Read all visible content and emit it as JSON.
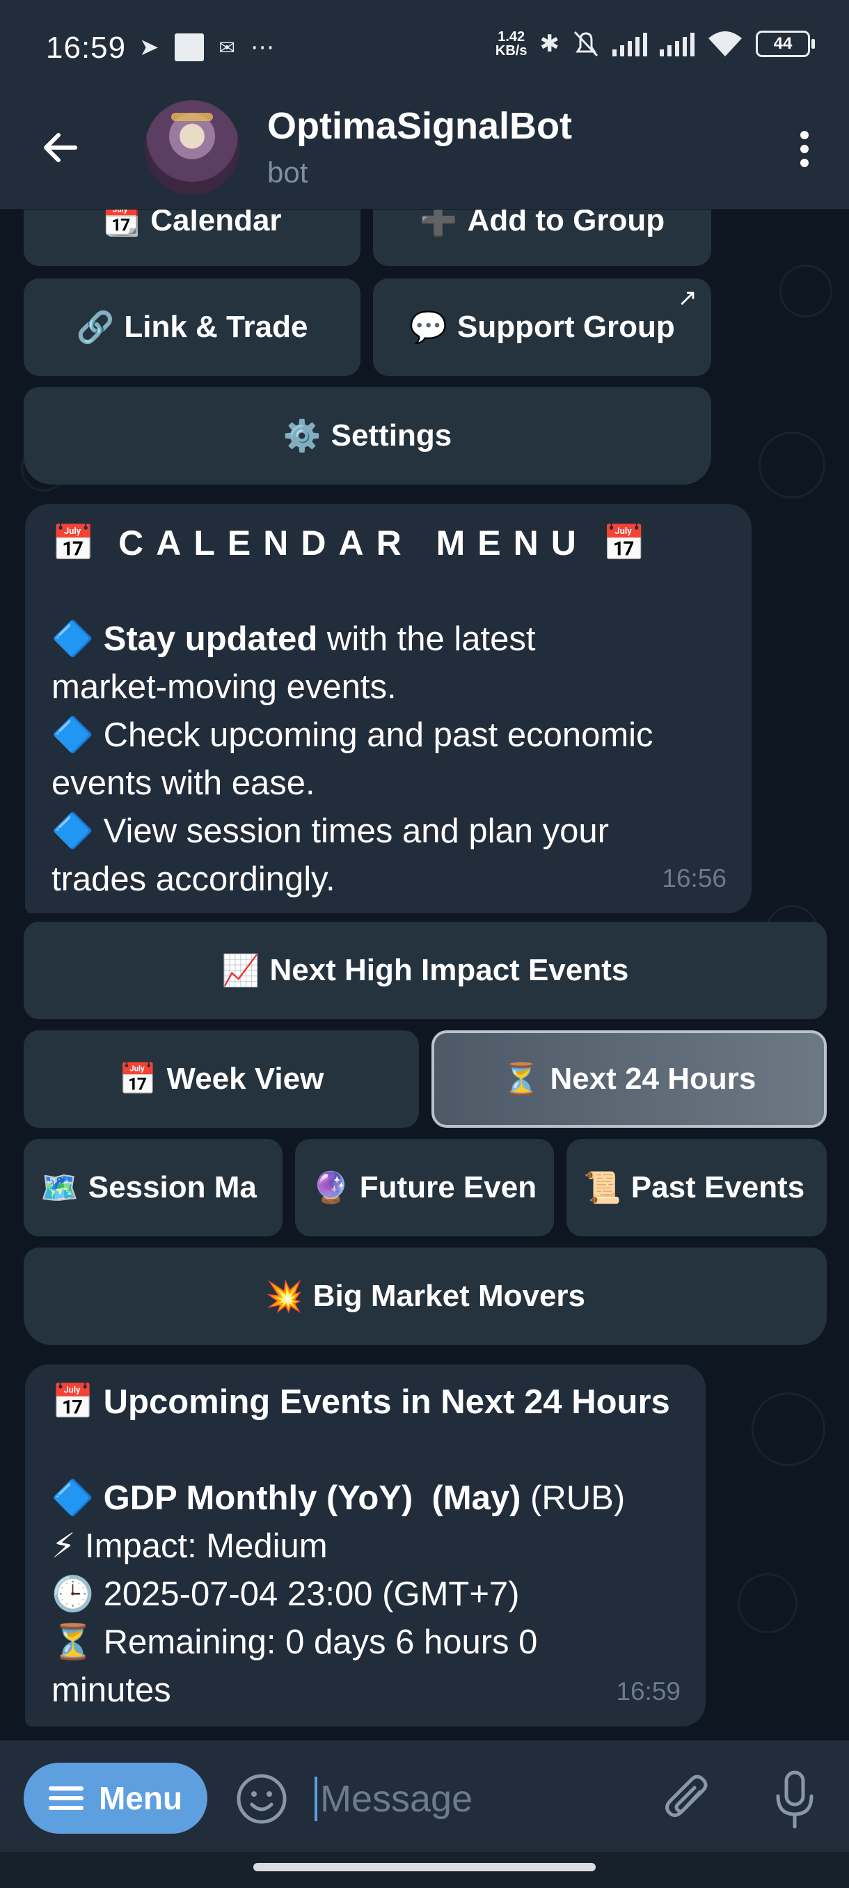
{
  "status_bar": {
    "time": "16:59",
    "net_speed_value": "1.42",
    "net_speed_unit": "KB/s",
    "battery": "44",
    "icons": [
      "telegram-icon",
      "square-notification-icon",
      "mail-icon",
      "more-dots-icon",
      "bluetooth-icon",
      "bell-off-icon",
      "signal-icon",
      "signal-icon",
      "wifi-icon",
      "battery-icon"
    ]
  },
  "header": {
    "title": "OptimaSignalBot",
    "subtitle": "bot"
  },
  "top_keyboard": {
    "row0": [
      {
        "icon": "📆",
        "label": "Calendar"
      },
      {
        "icon": "➕",
        "label": "Add to Group"
      }
    ],
    "row1": [
      {
        "icon": "🔗",
        "label": "Link & Trade"
      },
      {
        "icon": "💬",
        "label": "Support Group"
      }
    ],
    "row2": [
      {
        "icon": "⚙️",
        "label": "Settings"
      }
    ]
  },
  "calendar_message": {
    "title_icon": "📅",
    "title": "CALENDAR MENU",
    "bullet_icon": "🔷",
    "line1_bold": "Stay updated",
    "line1_rest": " with the latest",
    "line1_cont": "market-moving events.",
    "line2": "Check upcoming and past economic",
    "line2_cont": "events with ease.",
    "line3": "View session times and plan your",
    "line3_cont": "trades accordingly.",
    "time": "16:56"
  },
  "calendar_keyboard": {
    "high_impact": {
      "icon": "📈",
      "label": "Next High Impact Events"
    },
    "week_view": {
      "icon": "📅",
      "label": "Week View"
    },
    "next_24": {
      "icon": "⏳",
      "label": "Next 24 Hours"
    },
    "session_map": {
      "icon": "🗺️",
      "label": "Session Ma"
    },
    "future_events": {
      "icon": "🔮",
      "label": "Future Even"
    },
    "past_events": {
      "icon": "📜",
      "label": "Past Events"
    },
    "big_movers": {
      "icon": "💥",
      "label": "Big Market Movers"
    }
  },
  "events_message": {
    "title_icon": "📅",
    "title": "Upcoming Events in Next 24 Hours",
    "bullet_icon": "🔷",
    "event_name": "GDP Monthly (YoY)  (May)",
    "currency": " (RUB)",
    "impact_icon": "⚡",
    "impact": "Impact: Medium",
    "clock_icon": "🕒",
    "datetime": "2025-07-04 23:00 (GMT+7)",
    "hourglass_icon": "⏳",
    "remaining": "Remaining: 0 days 6 hours 0",
    "remaining_cont": "minutes",
    "time": "16:59"
  },
  "input_bar": {
    "menu_label": "Menu",
    "placeholder": "Message"
  },
  "colors": {
    "header_bg": "#212d3b",
    "chat_bg": "#0e1621",
    "bubble_bg": "#212d3b",
    "button_bg": "#25333f",
    "accent": "#5e9fe0"
  }
}
